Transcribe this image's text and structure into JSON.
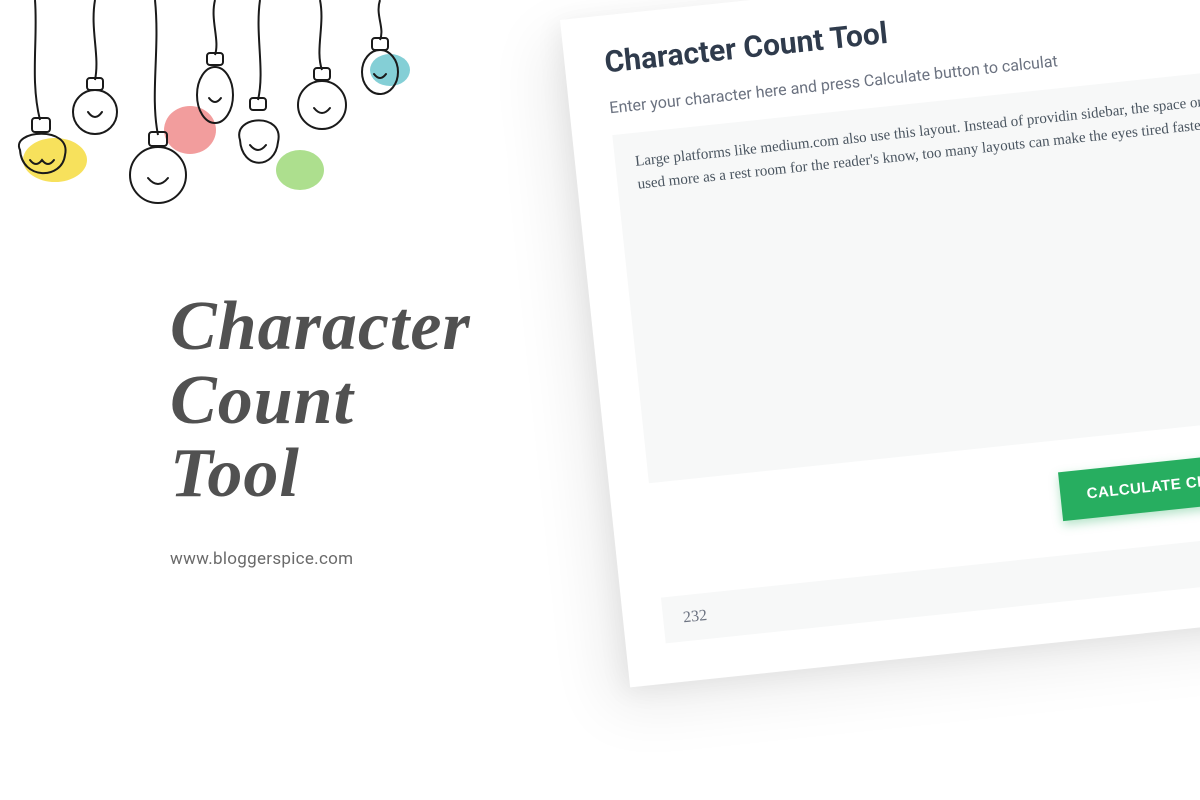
{
  "brand": {
    "title_line1": "Character",
    "title_line2": "Count",
    "title_line3": "Tool",
    "url": "www.bloggerspice.com"
  },
  "tool": {
    "heading": "Character Count Tool",
    "description": "Enter your character here and press Calculate button to calculat",
    "textarea_value": "Large platforms like medium.com also use this layout. Instead of providin sidebar, the space on the page is used more as a rest room for the reader's know, too many layouts can make the eyes tired faster.",
    "button_label": "CALCULATE CHARACTERS",
    "result_value": "232"
  },
  "colors": {
    "accent_green": "#27ae60",
    "heading_dark": "#2f3b4c",
    "text_gray": "#6b7280",
    "brand_gray": "#515151",
    "panel_bg": "#f7f8f8"
  }
}
